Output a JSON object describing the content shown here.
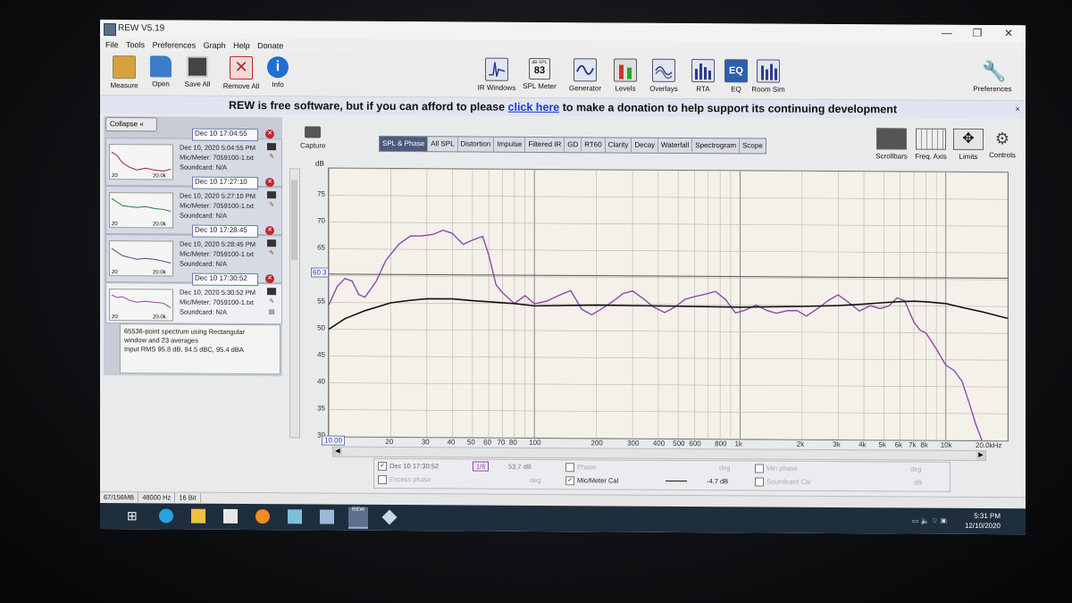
{
  "window": {
    "title": "REW V5.19",
    "minimize": "—",
    "restore": "❐",
    "close": "✕"
  },
  "menu": [
    "File",
    "Tools",
    "Preferences",
    "Graph",
    "Help",
    "Donate"
  ],
  "toolbar": {
    "left": [
      {
        "label": "Measure",
        "icon": "measure-icon",
        "color": "#c98a1c"
      },
      {
        "label": "Open",
        "icon": "folder-icon",
        "color": "#3d7cc9"
      },
      {
        "label": "Save All",
        "icon": "save-icon",
        "color": "#333333"
      },
      {
        "label": "Remove All",
        "icon": "remove-all-icon",
        "color": "#b62b2b"
      },
      {
        "label": "Info",
        "icon": "info-icon",
        "color": "#1f6ed4"
      }
    ],
    "middle": [
      {
        "label": "IR Windows",
        "icon": "ir-windows-icon"
      },
      {
        "label": "SPL Meter",
        "icon": "spl-meter-icon",
        "value": "83",
        "badge": "dB SPL"
      },
      {
        "label": "Generator",
        "icon": "generator-icon"
      },
      {
        "label": "Levels",
        "icon": "levels-icon"
      },
      {
        "label": "Overlays",
        "icon": "overlays-icon"
      },
      {
        "label": "RTA",
        "icon": "rta-icon"
      },
      {
        "label": "EQ",
        "icon": "eq-icon"
      },
      {
        "label": "Room Sim",
        "icon": "room-sim-icon"
      }
    ],
    "preferences": "Preferences"
  },
  "banner": {
    "prefix": "REW is free software, but if you can afford to please",
    "link": "click here",
    "suffix": "to make a donation to help support its continuing development",
    "close": "×"
  },
  "left_panel": {
    "collapse_label": "Collapse",
    "collapse_icon": "«",
    "measurements": [
      {
        "name": "Dec 10 17:04:55",
        "date": "Dec 10, 2020 5:04:55 PM",
        "cal": "Mic/Meter: 7059100-1.txt",
        "sound": "Soundcard: N/A",
        "lo": "20",
        "hi": "20.0k"
      },
      {
        "name": "Dec 10 17:27:10",
        "date": "Dec 10, 2020 5:27:10 PM",
        "cal": "Mic/Meter: 7059100-1.txt",
        "sound": "Soundcard: N/A",
        "lo": "20",
        "hi": "20.0k"
      },
      {
        "name": "Dec 10 17:28:45",
        "date": "Dec 10, 2020 5:28:45 PM",
        "cal": "Mic/Meter: 7059100-1.txt",
        "sound": "Soundcard: N/A",
        "lo": "20",
        "hi": "20.0k"
      },
      {
        "name": "Dec 10 17:30:52",
        "date": "Dec 10, 2020 5:30:52 PM",
        "cal": "Mic/Meter: 7059100-1.txt",
        "sound": "Soundcard: N/A",
        "lo": "20",
        "hi": "20.0k"
      }
    ],
    "note": [
      "65536-point spectrum using Rectangular",
      "window and 23 averages",
      "Input RMS 95.8 dB, 94.5 dBC, 95.4 dBA"
    ]
  },
  "capture_label": "Capture",
  "tabs": [
    "SPL & Phase",
    "All SPL",
    "Distortion",
    "Impulse",
    "Filtered IR",
    "GD",
    "RT60",
    "Clarity",
    "Decay",
    "Waterfall",
    "Spectrogram",
    "Scope"
  ],
  "active_tab": "SPL & Phase",
  "right_tools": [
    {
      "label": "Scrollbars",
      "icon": "scrollbars-icon"
    },
    {
      "label": "Freq. Axis",
      "icon": "freq-axis-icon"
    },
    {
      "label": "Limits",
      "icon": "limits-icon"
    },
    {
      "label": "Controls",
      "icon": "controls-icon"
    }
  ],
  "graph": {
    "y_unit": "dB",
    "y_marker": "60.3",
    "x_min_field": "10.00",
    "x_max_label": "20.0kHz",
    "y_ticks": [
      "75",
      "70",
      "65",
      "60",
      "55",
      "50",
      "45",
      "40",
      "35",
      "30"
    ],
    "x_ticks": [
      "20",
      "30",
      "40",
      "50",
      "60",
      "70",
      "80",
      "100",
      "200",
      "300",
      "400",
      "500",
      "600",
      "800",
      "1k",
      "2k",
      "3k",
      "4k",
      "5k",
      "6k",
      "7k",
      "8k",
      "10k"
    ]
  },
  "chart_data": {
    "type": "line",
    "xlabel": "",
    "ylabel": "dB",
    "x_scale": "log",
    "xlim": [
      10,
      20000
    ],
    "ylim": [
      30,
      80
    ],
    "grid": true,
    "series": [
      {
        "name": "Dec 10 17:30:52",
        "color": "#8e4aa8",
        "x": [
          10,
          11,
          12,
          13,
          14,
          15,
          17,
          19,
          22,
          25,
          28,
          32,
          36,
          40,
          45,
          50,
          56,
          60,
          65,
          70,
          80,
          90,
          100,
          115,
          130,
          150,
          170,
          190,
          210,
          240,
          270,
          300,
          340,
          380,
          430,
          480,
          540,
          600,
          680,
          760,
          850,
          950,
          1050,
          1200,
          1350,
          1500,
          1700,
          1900,
          2100,
          2400,
          2700,
          3000,
          3400,
          3800,
          4300,
          4800,
          5300,
          5800,
          6300,
          7000,
          7500,
          8000,
          8500,
          9000,
          10000,
          11000,
          12000,
          13000,
          14000,
          15000
        ],
        "y": [
          54.5,
          58,
          59.5,
          59,
          56.5,
          56,
          59,
          63,
          66,
          67.5,
          67.5,
          67.8,
          68.6,
          68,
          66,
          66.8,
          67.5,
          64,
          58.5,
          57,
          55,
          56.5,
          55,
          55.5,
          56.5,
          57.5,
          54,
          53,
          54,
          55.5,
          57,
          57.5,
          56,
          54.5,
          53.5,
          54.5,
          56,
          56.5,
          57,
          57.5,
          56,
          53.5,
          54,
          55,
          54,
          53.5,
          54,
          54,
          53,
          54.5,
          56,
          57,
          55.5,
          54,
          55,
          54.5,
          55,
          56.5,
          56,
          52,
          50.5,
          50,
          48.5,
          47,
          44,
          43,
          41,
          37,
          33,
          30
        ]
      },
      {
        "name": "Mic/Meter Cal",
        "color": "#111111",
        "x": [
          10,
          12,
          15,
          20,
          25,
          30,
          40,
          50,
          60,
          80,
          100,
          200,
          500,
          1000,
          2000,
          3000,
          4000,
          5000,
          6000,
          7000,
          8000,
          10000,
          12000,
          15000,
          20000
        ],
        "y": [
          50,
          52,
          53.5,
          55,
          55.5,
          55.8,
          55.8,
          55.5,
          55.3,
          55,
          54.6,
          54.8,
          54.7,
          54.6,
          54.8,
          55,
          55.3,
          55.6,
          55.8,
          55.9,
          55.8,
          55.5,
          54.8,
          54,
          52.8
        ]
      }
    ]
  },
  "legend": {
    "meas_name": "Dec 10 17:30:52",
    "smoothing": "1/6",
    "meas_value": "53.7 dB",
    "phase": "Phase",
    "deg1": "deg",
    "min_phase": "Min phase",
    "deg2": "deg",
    "excess_phase": "Excess phase",
    "deg3": "deg",
    "cal_name": "Mic/Meter Cal",
    "cal_value": "-4.7 dB",
    "soundcard_cal": "Soundcard Cal",
    "db": "dB"
  },
  "status": [
    "67/156MB",
    "48000 Hz",
    "16 Bit"
  ],
  "taskbar": {
    "apps": [
      {
        "icon": "windows-start-icon",
        "color": "#ffffff"
      },
      {
        "icon": "edge-icon",
        "color": "#2aa0e0"
      },
      {
        "icon": "file-explorer-icon",
        "color": "#f0c040"
      },
      {
        "icon": "store-icon",
        "color": "#e7e7e7"
      },
      {
        "icon": "firefox-icon",
        "color": "#f08a24"
      },
      {
        "icon": "app-icon",
        "color": "#7ac0d8"
      },
      {
        "icon": "calculator-icon",
        "color": "#9cb8d8"
      },
      {
        "icon": "rew-icon",
        "color": "#5b6f8a",
        "label": "REW"
      },
      {
        "icon": "app2-icon",
        "color": "#c8d8e8"
      }
    ],
    "time": "5:31 PM",
    "date": "12/10/2020"
  }
}
